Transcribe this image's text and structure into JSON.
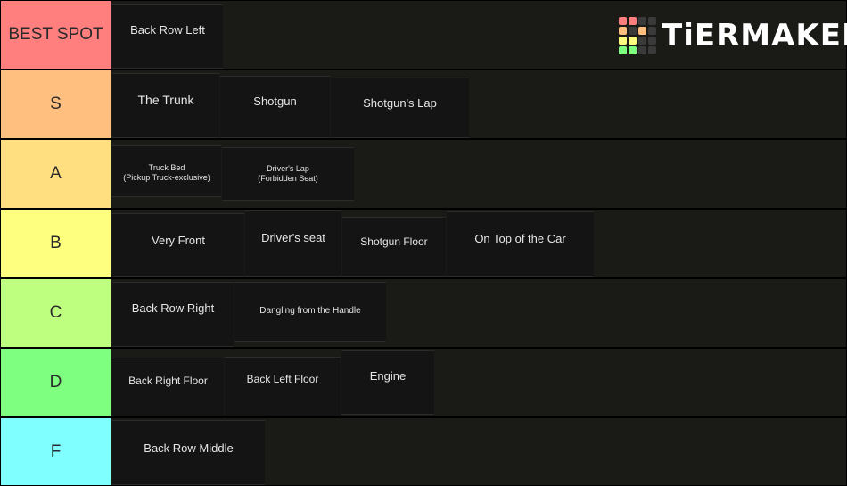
{
  "brand": {
    "logo_text": "TiERMAKER"
  },
  "tiers": [
    {
      "label": "BEST SPOT",
      "color": "#ff7f7f",
      "items": [
        {
          "text": "Back Row Left"
        }
      ]
    },
    {
      "label": "S",
      "color": "#ffbf7f",
      "items": [
        {
          "text": "The Trunk"
        },
        {
          "text": "Shotgun"
        },
        {
          "text": "Shotgun's Lap"
        }
      ]
    },
    {
      "label": "A",
      "color": "#ffdf7f",
      "items": [
        {
          "text": "Truck Bed\n(Pickup Truck-exclusive)"
        },
        {
          "text": "Driver's Lap\n(Forbidden Seat)"
        }
      ]
    },
    {
      "label": "B",
      "color": "#ffff7f",
      "items": [
        {
          "text": "Very Front"
        },
        {
          "text": "Driver's seat"
        },
        {
          "text": "Shotgun Floor"
        },
        {
          "text": "On Top of the Car"
        }
      ]
    },
    {
      "label": "C",
      "color": "#bfff7f",
      "items": [
        {
          "text": "Back Row Right"
        },
        {
          "text": "Dangling from the Handle"
        }
      ]
    },
    {
      "label": "D",
      "color": "#7fff7f",
      "items": [
        {
          "text": "Back Right Floor"
        },
        {
          "text": "Back Left Floor"
        },
        {
          "text": "Engine"
        }
      ]
    },
    {
      "label": "F",
      "color": "#7fffff",
      "items": [
        {
          "text": "Back Row Middle"
        }
      ]
    }
  ]
}
